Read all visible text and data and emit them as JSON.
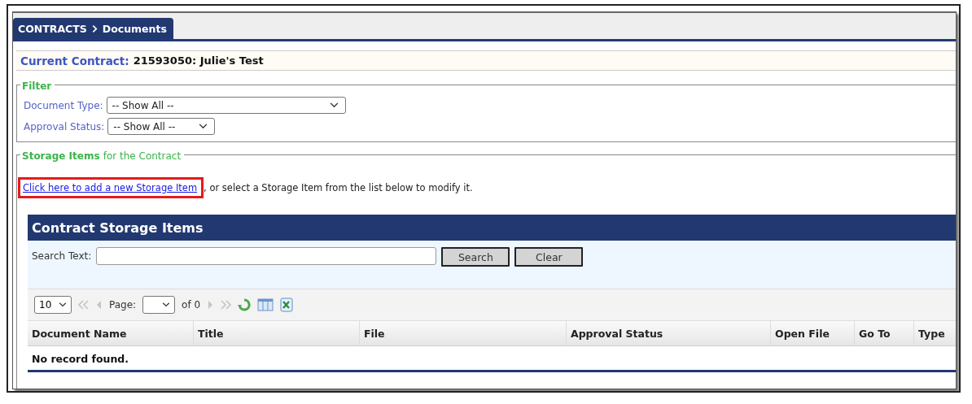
{
  "breadcrumb": [
    "CONTRACTS",
    "Documents"
  ],
  "current_contract": {
    "label": "Current Contract:",
    "value": "21593050: Julie's Test"
  },
  "filter": {
    "legend": "Filter",
    "fields": [
      {
        "label": "Document Type:",
        "value": "-- Show All --"
      },
      {
        "label": "Approval Status:",
        "value": "-- Show All --"
      }
    ]
  },
  "storage": {
    "legend_bold": "Storage Items",
    "legend_rest": "for the Contract",
    "link": "Click here to add a new Storage Item",
    "link_highlighted": true,
    "text": ", or select a Storage Item from the list below to modify it."
  },
  "grid": {
    "title": "Contract Storage Items",
    "search_label": "Search Text:",
    "buttons": [
      "Search",
      "Clear"
    ],
    "pager": {
      "page_size": "10",
      "page_label": "Page:",
      "of_text": "of 0",
      "first_disabled": true,
      "prev_disabled": true,
      "next_disabled": true,
      "last_disabled": true
    },
    "columns": [
      "Document Name",
      "Title",
      "File",
      "Approval Status",
      "Open File",
      "Go To",
      "Type"
    ],
    "empty_text": "No record found."
  }
}
